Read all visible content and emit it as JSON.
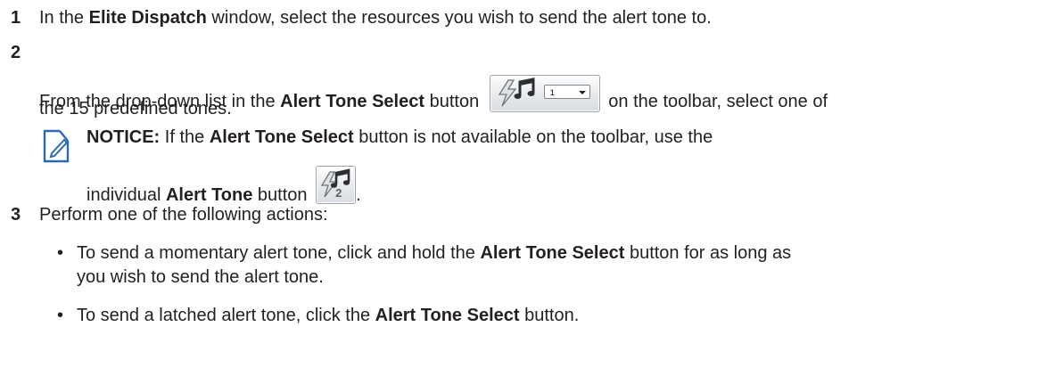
{
  "step1": {
    "number": "1",
    "text_a": "In the ",
    "bold_a": "Elite Dispatch",
    "text_b": " window, select the resources you wish to send the alert tone to."
  },
  "step2": {
    "number": "2",
    "text_a": "From the drop-down list in the ",
    "bold_a": "Alert Tone Select",
    "text_b": " button ",
    "text_c": " on the toolbar, select one of",
    "line2": "the 15 predefined tones.",
    "button_combo_value": "1"
  },
  "notice": {
    "label": "NOTICE:",
    "text_a": " If the ",
    "bold_a": "Alert Tone Select",
    "text_b": " button is not available on the toolbar, use the",
    "text_c": "individual ",
    "bold_b": "Alert Tone",
    "text_d": " button ",
    "text_e": ".",
    "button_number": "2",
    "icon": "pencil-icon",
    "icon_color": "#2a6ab3"
  },
  "step3": {
    "number": "3",
    "text": "Perform one of the following actions:",
    "bullets": [
      {
        "marker": "•",
        "text_a": "To send a momentary alert tone, click and hold the ",
        "bold_a": "Alert Tone Select",
        "text_b": " button for as long as",
        "line2": "you wish to send the alert tone."
      },
      {
        "marker": "•",
        "text_a": "To send a latched alert tone, click the ",
        "bold_a": "Alert Tone Select",
        "text_b": " button."
      }
    ]
  }
}
